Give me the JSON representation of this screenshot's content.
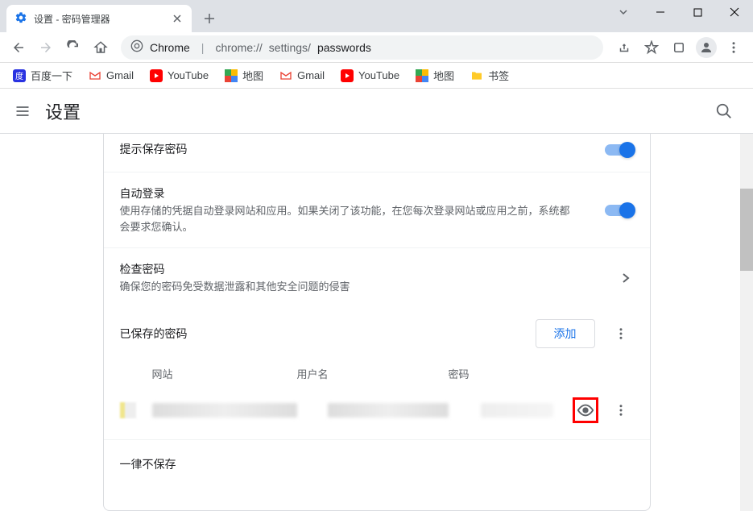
{
  "tab": {
    "title": "设置 - 密码管理器"
  },
  "omnibox": {
    "prefix": "Chrome",
    "sep": "|",
    "url_chrome": "chrome://",
    "url_path": "settings/",
    "url_last": "passwords"
  },
  "bookmarks": [
    {
      "label": "百度一下",
      "icon": "baidu"
    },
    {
      "label": "Gmail",
      "icon": "gmail"
    },
    {
      "label": "YouTube",
      "icon": "youtube"
    },
    {
      "label": "地图",
      "icon": "maps"
    },
    {
      "label": "Gmail",
      "icon": "gmail"
    },
    {
      "label": "YouTube",
      "icon": "youtube"
    },
    {
      "label": "地图",
      "icon": "maps"
    },
    {
      "label": "书签",
      "icon": "folder"
    }
  ],
  "settings": {
    "title": "设置"
  },
  "rows": {
    "save_prompt": {
      "title": "提示保存密码"
    },
    "auto_login": {
      "title": "自动登录",
      "sub": "使用存储的凭据自动登录网站和应用。如果关闭了该功能，在您每次登录网站或应用之前，系统都会要求您确认。"
    },
    "check": {
      "title": "检查密码",
      "sub": "确保您的密码免受数据泄露和其他安全问题的侵害"
    }
  },
  "saved": {
    "title": "已保存的密码",
    "add": "添加",
    "cols": {
      "site": "网站",
      "user": "用户名",
      "pass": "密码"
    }
  },
  "never_save": "一律不保存"
}
